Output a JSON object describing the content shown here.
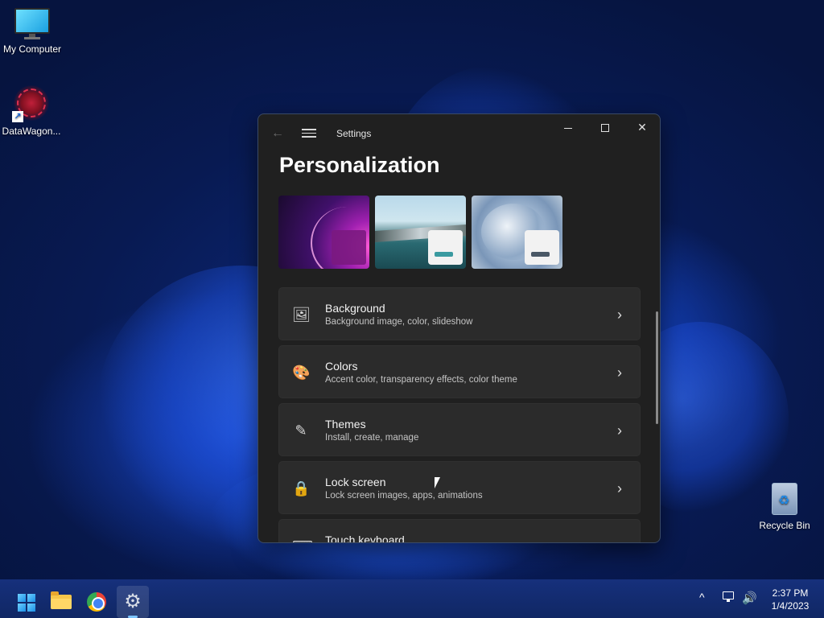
{
  "desktop": {
    "icons": [
      {
        "label": "My Computer",
        "icon": "monitor-icon"
      },
      {
        "label": "DataWagon...",
        "icon": "datawagon-icon"
      },
      {
        "label": "Recycle Bin",
        "icon": "recycle-bin-icon"
      }
    ]
  },
  "window": {
    "title": "Settings",
    "back_icon": "←",
    "close_icon": "✕",
    "page_title": "Personalization",
    "themes": [
      "windows-bloom-dark-theme",
      "glow-captured-motion-theme",
      "windows-bloom-light-theme"
    ],
    "items": [
      {
        "title": "Background",
        "subtitle": "Background image, color, slideshow",
        "icon": "🖼",
        "chevron": "›"
      },
      {
        "title": "Colors",
        "subtitle": "Accent color, transparency effects, color theme",
        "icon": "🎨",
        "chevron": "›"
      },
      {
        "title": "Themes",
        "subtitle": "Install, create, manage",
        "icon": "✎",
        "chevron": "›"
      },
      {
        "title": "Lock screen",
        "subtitle": "Lock screen images, apps, animations",
        "icon": "🔒",
        "chevron": "›"
      },
      {
        "title": "Touch keyboard",
        "subtitle": "",
        "icon": "⌨",
        "chevron": "›"
      }
    ]
  },
  "taskbar": {
    "apps": [
      "start-button",
      "file-explorer",
      "google-chrome",
      "settings"
    ],
    "tray_chevron": "^",
    "volume_icon": "🔊",
    "gear_glyph": "⚙",
    "time": "2:37 PM",
    "date": "1/4/2023"
  }
}
